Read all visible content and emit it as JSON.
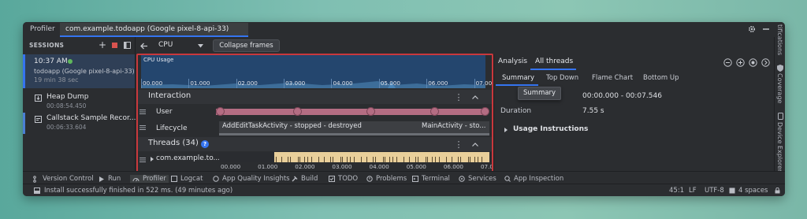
{
  "titlebar": {
    "tool_title": "Profiler",
    "process_tab": "com.example.todoapp (Google pixel-8-api-33)"
  },
  "sessions": {
    "header": "SESSIONS",
    "session": {
      "time": "10:37 AM",
      "app": "todoapp (Google pixel-8-api-33)",
      "duration": "19 min 38 sec"
    },
    "artifacts": [
      {
        "name": "Heap Dump",
        "time": "00:08:54.450"
      },
      {
        "name": "Callstack Sample Recor...",
        "time": "00:06:33.604"
      }
    ]
  },
  "toolbar": {
    "cpu_select": "CPU",
    "collapse_button": "Collapse frames"
  },
  "cpu_usage": {
    "label": "CPU Usage",
    "ticks": [
      "00.000",
      "01.000",
      "02.000",
      "03.000",
      "04.000",
      "05.000",
      "06.000",
      "07.000"
    ]
  },
  "interaction": {
    "header": "Interaction",
    "user_label": "User",
    "lifecycle_label": "Lifecycle",
    "lifecycle_events": [
      "AddEditTaskActivity - stopped - destroyed",
      "MainActivity - sto..."
    ]
  },
  "threads": {
    "header": "Threads (34)",
    "thread_name": "com.example.to...",
    "ticks": [
      "00.000",
      "01.000",
      "02.000",
      "03.000",
      "04.000",
      "05.000",
      "06.000",
      "07.000"
    ]
  },
  "analysis": {
    "tabs": [
      "Analysis",
      "All threads"
    ],
    "subtabs": [
      "Summary",
      "Top Down",
      "Flame Chart",
      "Bottom Up"
    ],
    "tooltip": "Summary",
    "range_value": "00:00.000 - 00:07.546",
    "duration_label": "Duration",
    "duration_value": "7.55 s",
    "usage_instructions": "Usage Instructions"
  },
  "right_strip": {
    "notifications": "tifications",
    "coverage": "Coverage",
    "device_explorer": "Device Explorer"
  },
  "bottom_toolbar": {
    "items": [
      "Version Control",
      "Run",
      "Profiler",
      "Logcat",
      "App Quality Insights",
      "Build",
      "TODO",
      "Problems",
      "Terminal",
      "Services",
      "App Inspection"
    ]
  },
  "statusbar": {
    "message": "Install successfully finished in 522 ms. (49 minutes ago)",
    "position": "45:1",
    "line_ending": "LF",
    "encoding": "UTF-8",
    "indent": "4 spaces"
  },
  "colors": {
    "accent": "#3574f0",
    "session_dot": "#5fb85c",
    "cpu_fill": "#2e5a8a",
    "user_track": "#b46d83",
    "thread_active": "#e9cf9a",
    "highlight": "#c9383c"
  }
}
